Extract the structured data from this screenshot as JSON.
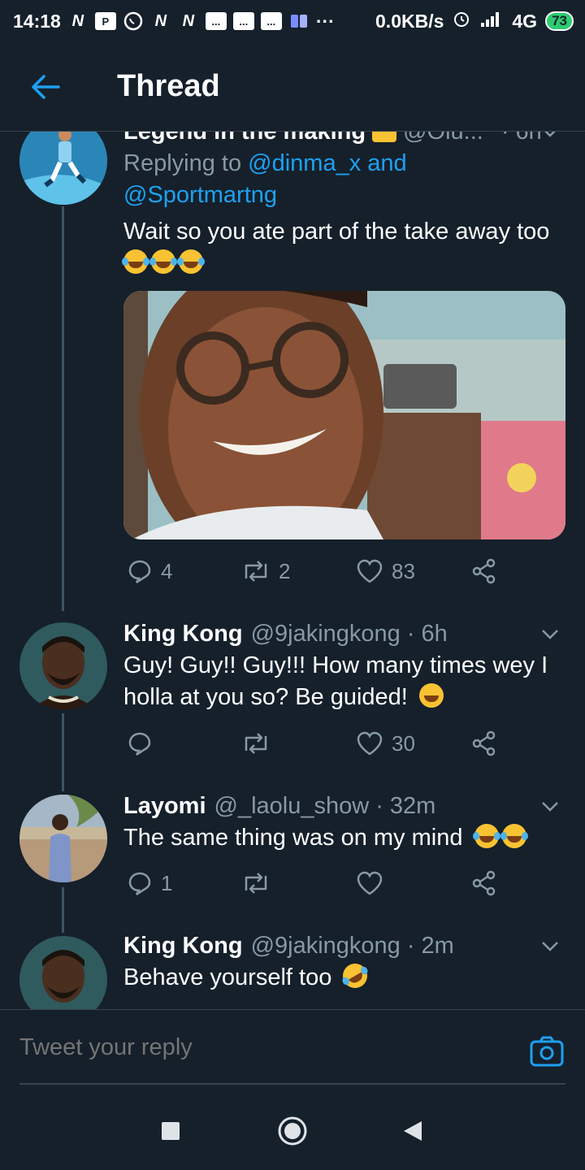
{
  "status_bar": {
    "time": "14:18",
    "notif_icons": [
      "N",
      "P",
      "W",
      "N",
      "N",
      "...",
      "...",
      "..."
    ],
    "more": "···",
    "net_speed": "0.0KB/s",
    "network": "4G",
    "battery": "73"
  },
  "header": {
    "title": "Thread"
  },
  "tweets": [
    {
      "name_partial": "Legend in the making",
      "handle_partial": "@Olu...",
      "time_partial": "· 6h",
      "reply_prefix": "Replying to",
      "reply_mention_1": "@dinma_x",
      "reply_and": "and",
      "reply_mention_2": "@Sportmartng",
      "body": "Wait so you ate part of the take away too",
      "emoji_count": 3,
      "replies": "4",
      "retweets": "2",
      "likes": "83"
    },
    {
      "name": "King Kong",
      "handle": "@9jakingkong",
      "time": "· 6h",
      "body": "Guy! Guy!! Guy!!! How many times wey I holla at you so? Be guided!",
      "replies": "",
      "retweets": "",
      "likes": "30"
    },
    {
      "name": "Layomi",
      "handle": "@_laolu_show",
      "time": "· 32m",
      "body": "The same thing was on my mind",
      "replies": "1",
      "retweets": "",
      "likes": ""
    },
    {
      "name": "King Kong",
      "handle": "@9jakingkong",
      "time": "· 2m",
      "body": "Behave yourself too"
    }
  ],
  "composer": {
    "placeholder": "Tweet your reply"
  },
  "icons": {
    "back": "arrow-left-icon",
    "reply": "comment-icon",
    "retweet": "retweet-icon",
    "like": "heart-icon",
    "share": "share-icon",
    "camera": "camera-icon"
  },
  "colors": {
    "background": "#15202b",
    "accent": "#1da1f2",
    "muted": "#8899a6",
    "divider": "#38444d"
  }
}
